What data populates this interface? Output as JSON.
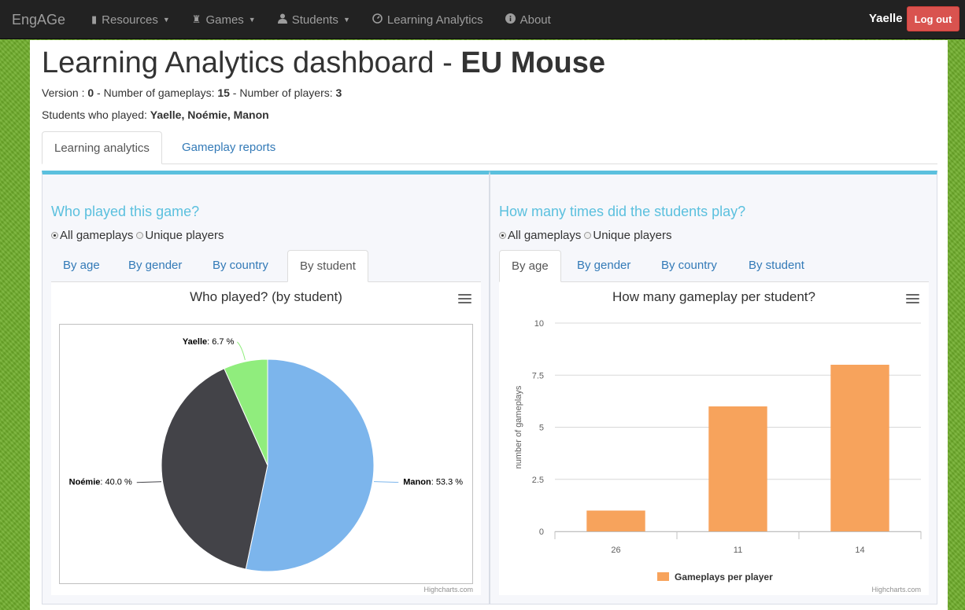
{
  "navbar": {
    "brand": "EngAGe",
    "items": [
      {
        "label": "Resources",
        "icon": "book-icon"
      },
      {
        "label": "Games",
        "icon": "rook-icon"
      },
      {
        "label": "Students",
        "icon": "user-icon"
      },
      {
        "label": "Learning Analytics",
        "icon": "dashboard-icon"
      },
      {
        "label": "About",
        "icon": "info-icon"
      }
    ],
    "user": "Yaelle",
    "logout": "Log out"
  },
  "page": {
    "title_prefix": "Learning Analytics dashboard - ",
    "title_game": "EU Mouse",
    "version_label": "Version : ",
    "version": "0",
    "gameplays_label": " - Number of gameplays: ",
    "gameplays": "15",
    "players_label": " - Number of players: ",
    "players": "3",
    "students_label": "Students who played: ",
    "students": "Yaelle, Noémie, Manon"
  },
  "main_tabs": [
    "Learning analytics",
    "Gameplay reports"
  ],
  "radio_labels": [
    "All gameplays",
    "Unique players"
  ],
  "sub_tabs": [
    "By age",
    "By gender",
    "By country",
    "By student"
  ],
  "credits": "Highcharts.com",
  "panels": {
    "left": {
      "title": "Who played this game?"
    },
    "right": {
      "title": "How many times did the students play?"
    }
  },
  "chart_data": [
    {
      "type": "pie",
      "title": "Who played? (by student)",
      "slices": [
        {
          "name": "Manon",
          "value": 53.3,
          "label": "53.3 %",
          "color": "#7cb5ec"
        },
        {
          "name": "Noémie",
          "value": 40.0,
          "label": "40.0 %",
          "color": "#434348"
        },
        {
          "name": "Yaelle",
          "value": 6.7,
          "label": "6.7 %",
          "color": "#90ed7d"
        }
      ]
    },
    {
      "type": "bar",
      "title": "How many gameplay per student?",
      "categories": [
        "26",
        "11",
        "14"
      ],
      "series": [
        {
          "name": "Gameplays per player",
          "values": [
            1,
            6,
            8
          ],
          "color": "#f7a35c"
        }
      ],
      "ylabel": "number of gameplays",
      "ylim": [
        0,
        10
      ],
      "yticks": [
        "0",
        "2.5",
        "5",
        "7.5",
        "10"
      ],
      "grid": true,
      "legend": "bottom-center"
    }
  ]
}
